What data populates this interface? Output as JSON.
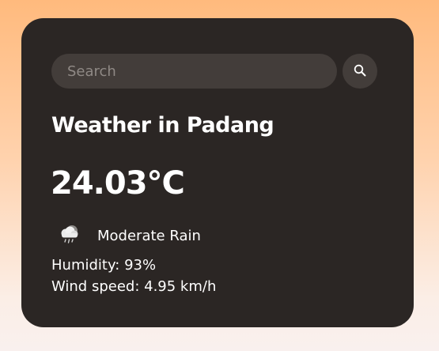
{
  "search": {
    "placeholder": "Search",
    "value": "",
    "button_icon": "search-icon"
  },
  "weather": {
    "title": "Weather in Padang",
    "temperature": "24.03°C",
    "condition_icon": "rain-cloud-icon",
    "condition": "Moderate Rain",
    "humidity": "Humidity: 93%",
    "wind": "Wind speed: 4.95 km/h"
  },
  "colors": {
    "card_background": "#2b2624",
    "input_background": "#433d3a",
    "gradient_top": "#ffba7d",
    "gradient_bottom": "#f9f0ee",
    "text": "#ffffff"
  }
}
